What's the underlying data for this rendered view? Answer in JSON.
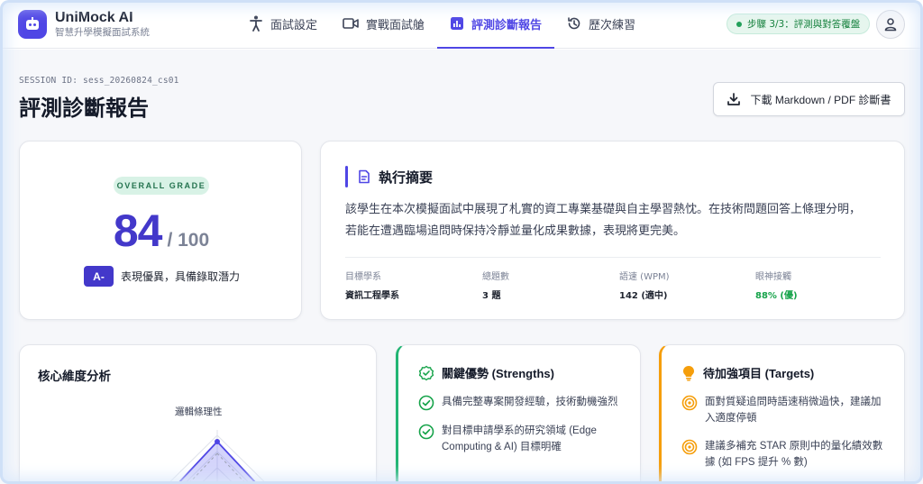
{
  "brand": {
    "name": "UniMock AI",
    "subtitle": "智慧升學模擬面試系統"
  },
  "nav": {
    "items": [
      {
        "label": "面試設定",
        "icon": "person-standing-icon"
      },
      {
        "label": "實戰面試艙",
        "icon": "video-camera-icon"
      },
      {
        "label": "評測診斷報告",
        "icon": "bar-chart-icon",
        "active": true
      },
      {
        "label": "歷次練習",
        "icon": "history-icon"
      }
    ]
  },
  "step_badge": "步驟 3/3：評測與對答覆盤",
  "session_id": "SESSION ID: sess_20260824_cs01",
  "page_title": "評測診斷報告",
  "download_label": "下載 Markdown / PDF 診斷書",
  "grade": {
    "pill": "OVERALL GRADE",
    "score": "84",
    "max": "/ 100",
    "letter": "A-",
    "description": "表現優異，具備錄取潛力"
  },
  "summary": {
    "title": "執行摘要",
    "text": "該學生在本次模擬面試中展現了札實的資工專業基礎與自主學習熱忱。在技術問題回答上條理分明，若能在遭遇臨場追問時保持冷靜並量化成果數據，表現將更完美。",
    "stats": [
      {
        "label": "目標學系",
        "value": "資訊工程學系"
      },
      {
        "label": "總題數",
        "value": "3 題"
      },
      {
        "label": "語速 (WPM)",
        "value": "142 (適中)"
      },
      {
        "label": "眼神接觸",
        "value": "88% (優)"
      }
    ]
  },
  "radar": {
    "title": "核心維度分析",
    "axis_top": "邏輯條理性"
  },
  "strengths": {
    "title": "關鍵優勢 (Strengths)",
    "items": [
      "具備完整專案開發經驗，技術動機強烈",
      "對目標申請學系的研究領域 (Edge Computing & AI) 目標明確"
    ]
  },
  "targets": {
    "title": "待加強項目 (Targets)",
    "items": [
      "面對質疑追問時語速稍微過快，建議加入適度停頓",
      "建議多補充 STAR 原則中的量化績效數據 (如 FPS 提升 % 數)"
    ]
  },
  "colors": {
    "accent": "#4f46e5",
    "success": "#22b573",
    "warning": "#f59e0b"
  }
}
